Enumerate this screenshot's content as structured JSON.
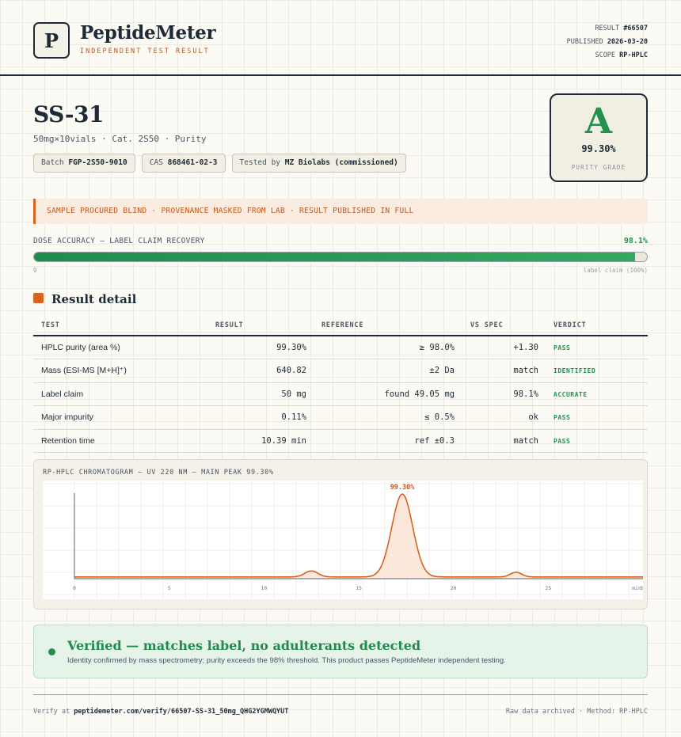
{
  "header": {
    "logo_letter": "P",
    "brand": "PeptideMeter",
    "brand_sub": "INDEPENDENT TEST RESULT",
    "result_label": "RESULT",
    "result_id": "#66507",
    "published_label": "PUBLISHED",
    "published_date": "2026-03-20",
    "scope_label": "SCOPE",
    "scope_value": "RP-HPLC"
  },
  "product": {
    "name": "SS-31",
    "subtitle": "50mg×10vials · Cat. 2S50 · Purity",
    "chips": {
      "batch_label": "Batch",
      "batch_value": "FGP-2S50-9010",
      "cas_label": "CAS",
      "cas_value": "868461-02-3",
      "tested_label": "Tested by",
      "tested_value": "MZ Biolabs (commissioned)"
    }
  },
  "grade": {
    "letter": "A",
    "value": "99.30%",
    "label": "PURITY GRADE",
    "color": "#22914f"
  },
  "banner": {
    "text": "SAMPLE PROCURED BLIND · PROVENANCE MASKED FROM LAB · RESULT PUBLISHED IN FULL"
  },
  "dose": {
    "label": "DOSE ACCURACY — LABEL CLAIM RECOVERY",
    "value_text": "98.1%",
    "fraction": 0.981,
    "scale_min": "0",
    "scale_max": "label claim (100%)"
  },
  "results": {
    "section_title": "Result detail",
    "headers": {
      "test": "TEST",
      "result": "RESULT",
      "reference": "REFERENCE",
      "vs_spec": "VS SPEC",
      "verdict": "VERDICT"
    },
    "rows": [
      {
        "test": "HPLC purity (area %)",
        "result": "99.30%",
        "reference": "≥ 98.0%",
        "vs_spec": "+1.30",
        "verdict": "PASS"
      },
      {
        "test": "Mass (ESI-MS [M+H]⁺)",
        "result": "640.82",
        "reference": "±2 Da",
        "vs_spec": "match",
        "verdict": "IDENTIFIED"
      },
      {
        "test": "Label claim",
        "result": "50 mg",
        "reference": "found 49.05 mg",
        "vs_spec": "98.1%",
        "verdict": "ACCURATE"
      },
      {
        "test": "Major impurity",
        "result": "0.11%",
        "reference": "≤ 0.5%",
        "vs_spec": "ok",
        "verdict": "PASS"
      },
      {
        "test": "Retention time",
        "result": "10.39 min",
        "reference": "ref ±0.3",
        "vs_spec": "match",
        "verdict": "PASS"
      }
    ]
  },
  "chart_data": {
    "type": "line",
    "title": "RP-HPLC CHROMATOGRAM — UV 220 NM — MAIN PEAK 99.30%",
    "xlabel": "",
    "ylabel": "",
    "x_ticks": [
      "0",
      "5",
      "10",
      "15",
      "20",
      "25",
      "30",
      "min"
    ],
    "xlim": [
      0,
      30
    ],
    "ylim": [
      0,
      1
    ],
    "baseline": 0.02,
    "peaks": [
      {
        "rt": 12.5,
        "height": 0.07,
        "width": 0.35
      },
      {
        "rt": 17.3,
        "height": 0.97,
        "width": 0.55
      },
      {
        "rt": 23.3,
        "height": 0.055,
        "width": 0.3
      }
    ],
    "peak_label": "99.30%",
    "grid": true,
    "line_color": "#d9621f"
  },
  "verified": {
    "title": "Verified — matches label, no adulterants detected",
    "text": "Identity confirmed by mass spectrometry; purity exceeds the 98% threshold. This product passes PeptideMeter independent testing."
  },
  "footer": {
    "verify_label": "Verify at",
    "verify_url": "peptidemeter.com/verify/66507-SS-31_50mg_QHG2YGMWQYUT",
    "right_text": "Raw data archived · Method: RP-HPLC"
  }
}
